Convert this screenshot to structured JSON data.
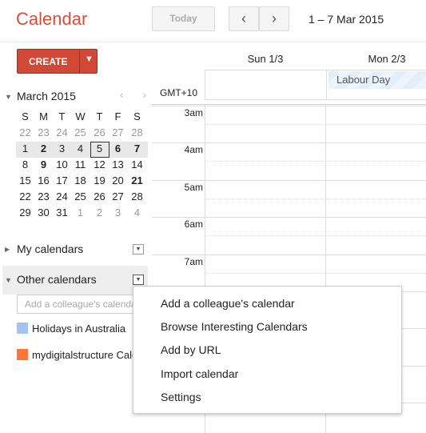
{
  "header": {
    "logo": "Calendar",
    "today": "Today",
    "prev": "‹",
    "next": "›",
    "range": "1 – 7 Mar 2015"
  },
  "create": {
    "label": "CREATE",
    "arrow": "▼"
  },
  "mini_cal": {
    "title": "March 2015",
    "nav": "‹ ›",
    "weekdays": [
      "S",
      "M",
      "T",
      "W",
      "T",
      "F",
      "S"
    ],
    "weeks": [
      [
        "22",
        "23",
        "24",
        "25",
        "26",
        "27",
        "28"
      ],
      [
        "1",
        "2",
        "3",
        "4",
        "5",
        "6",
        "7"
      ],
      [
        "8",
        "9",
        "10",
        "11",
        "12",
        "13",
        "14"
      ],
      [
        "15",
        "16",
        "17",
        "18",
        "19",
        "20",
        "21"
      ],
      [
        "22",
        "23",
        "24",
        "25",
        "26",
        "27",
        "28"
      ],
      [
        "29",
        "30",
        "31",
        "1",
        "2",
        "3",
        "4"
      ]
    ],
    "today": "5"
  },
  "sidebar": {
    "my_calendars": "My calendars",
    "other_calendars": "Other calendars",
    "add_placeholder": "Add a colleague's calendar",
    "calendars": [
      {
        "name": "Holidays in Australia",
        "color": "#a4c2f4"
      },
      {
        "name": "mydigitalstructure Calendar",
        "color": "#ff7537"
      }
    ]
  },
  "grid": {
    "timezone": "GMT+10",
    "days": [
      "Sun 1/3",
      "Mon 2/3"
    ],
    "event": "Labour Day",
    "hours": [
      "3am",
      "4am",
      "5am",
      "6am",
      "7am"
    ]
  },
  "menu": {
    "items": [
      "Add a colleague's calendar",
      "Browse Interesting Calendars",
      "Add by URL",
      "Import calendar",
      "Settings"
    ]
  }
}
